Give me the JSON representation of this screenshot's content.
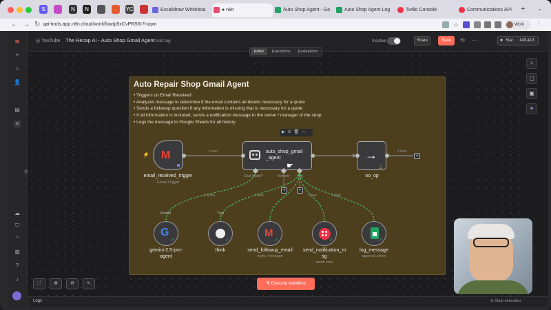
{
  "browser": {
    "tabs": [
      {
        "label": "Excalidraw Whiteboa",
        "color": "#6965db"
      },
      {
        "label": "n8n",
        "color": "#ea4b71",
        "active": true
      },
      {
        "label": "Auto Shop Agent - Go",
        "color": "#1fa463"
      },
      {
        "label": "Auto Shop Agent Log",
        "color": "#1fa463"
      },
      {
        "label": "Twilio Console",
        "color": "#f22f46"
      },
      {
        "label": "Communications API",
        "color": "#f22f46"
      }
    ],
    "url": "ai-tools.app.n8n.cloud/workflow/p5xCvPRS6r7ruqxn",
    "profile": "Work"
  },
  "header": {
    "project": "YouTube",
    "workflow_name": "The Recap AI - Auto Shop Gmail Agent",
    "add_tag": "+ Add tag",
    "inactive_label": "Inactive",
    "share": "Share",
    "save": "Save",
    "star": "Star",
    "star_count": "140,413",
    "tabs": [
      "Editor",
      "Executions",
      "Evaluations"
    ]
  },
  "sticky": {
    "title": "Auto Repair Shop Gmail Agent",
    "bullets": [
      "Triggers on Email Received",
      "Analyzes message to determine if the email contains all details necessary for a quote",
      "Sends a followup question if any information is missing that is necessary for a quote",
      "If all information is included, sends a notification message to the owner / manager of the shop",
      "Logs the message to Google Sheets for all history"
    ]
  },
  "nodes": {
    "trigger": {
      "label": "email_received_trigger",
      "sub": "Gmail Trigger"
    },
    "agent": {
      "label": "auto_shop_gmail_agent",
      "line1": "auto_shop_gmail",
      "line2": "_agent"
    },
    "noop": {
      "label": "no_op"
    },
    "gemini": {
      "label1": "gemini-2.5-pro-",
      "label2": "agent",
      "tag": "Model"
    },
    "think": {
      "label": "think",
      "tag": "Tool"
    },
    "followup": {
      "label": "send_followup_email",
      "sub": "reply: message"
    },
    "notify": {
      "label1": "send_notification_m",
      "label2": "sg",
      "sub": "send: sms"
    },
    "log": {
      "label": "log_message",
      "sub": "append: sheet"
    }
  },
  "connections": {
    "trigger_to_agent": "1 item",
    "agent_to_noop": "1 item",
    "model": "2 items",
    "tool_followup": "1 item",
    "tool_notify": "1 item",
    "tool_log": "1 item"
  },
  "agent_ports": [
    "Chat Model*",
    "Memory",
    "Tool"
  ],
  "execute_button": "Execute workflow",
  "footer": {
    "logs": "Logs",
    "clear": "Clear execution"
  },
  "colors": {
    "accent": "#ff6d5a",
    "sticky_bg": "#4d3f1e",
    "success": "#4fcf6f",
    "gmail_red": "#ea4335"
  }
}
